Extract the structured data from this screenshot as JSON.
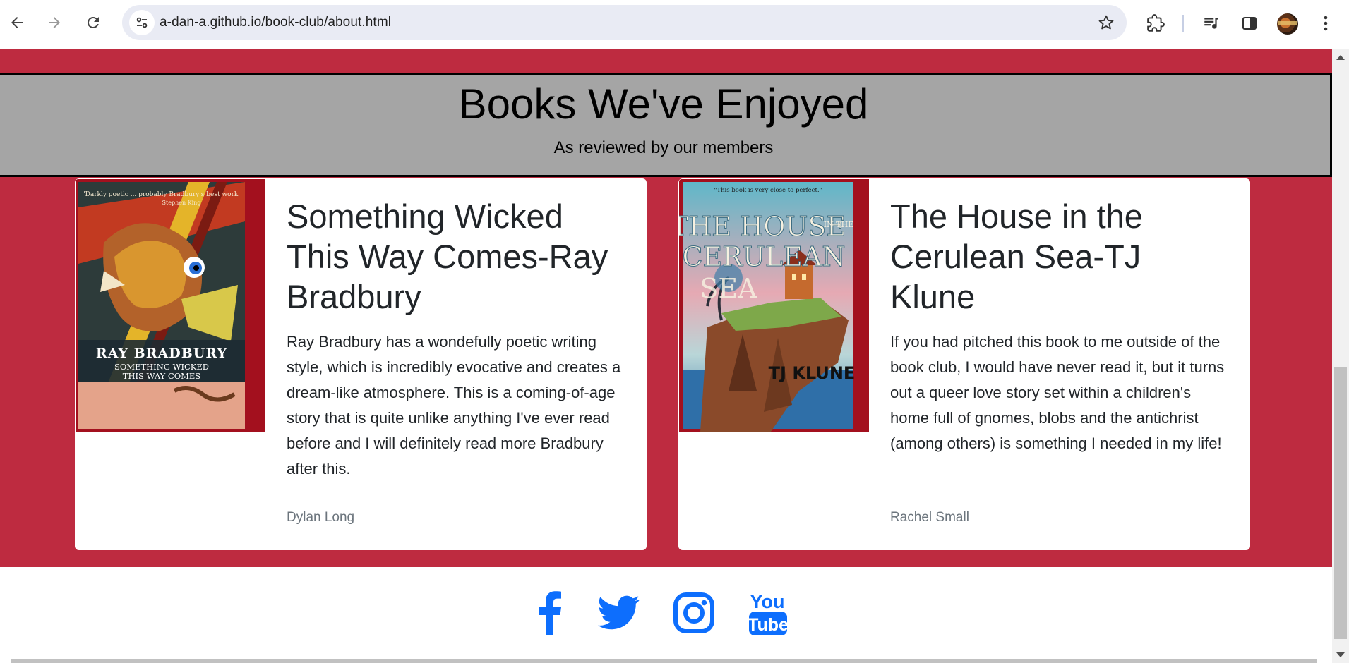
{
  "browser": {
    "url": "a-dan-a.github.io/book-club/about.html"
  },
  "hero": {
    "title": "Books We've Enjoyed",
    "subtitle": "As reviewed by our members"
  },
  "books": [
    {
      "title": "Something Wicked This Way Comes-Ray Bradbury",
      "review": "Ray Bradbury has a wondefully poetic writing style, which is incredibly evocative and creates a dream-like atmosphere. This is a coming-of-age story that is quite unlike anything I've ever read before and I will definitely read more Bradbury after this.",
      "reviewer": "Dylan Long",
      "cover": {
        "quote": "'Darkly poetic ... probably Bradbury's best work'",
        "quote_by": "Stephen King",
        "author_line": "RAY BRADBURY",
        "title_line_1": "SOMETHING WICKED",
        "title_line_2": "THIS WAY COMES"
      }
    },
    {
      "title": "The House in the Cerulean Sea-TJ Klune",
      "review": "If you had pitched this book to me outside of the book club, I would have never read it, but it turns out a queer love story set within a children's home full of gnomes, blobs and the antichrist (among others) is something I needed in my life!",
      "reviewer": "Rachel Small",
      "cover": {
        "quote": "\"This book is very close to perfect.\"",
        "title_line_1": "THE HOUSE",
        "title_small": "IN THE",
        "title_line_2": "CERULEAN",
        "title_line_3": "SEA",
        "author_line": "TJ KLUNE"
      }
    }
  ],
  "footer": {
    "social": [
      "facebook-icon",
      "twitter-icon",
      "instagram-icon",
      "youtube-icon"
    ],
    "youtube_you": "You",
    "youtube_tube": "Tube"
  },
  "colors": {
    "page_bg": "#be2b40",
    "hero_bg": "#a5a5a5",
    "social_blue": "#0d6efd"
  }
}
